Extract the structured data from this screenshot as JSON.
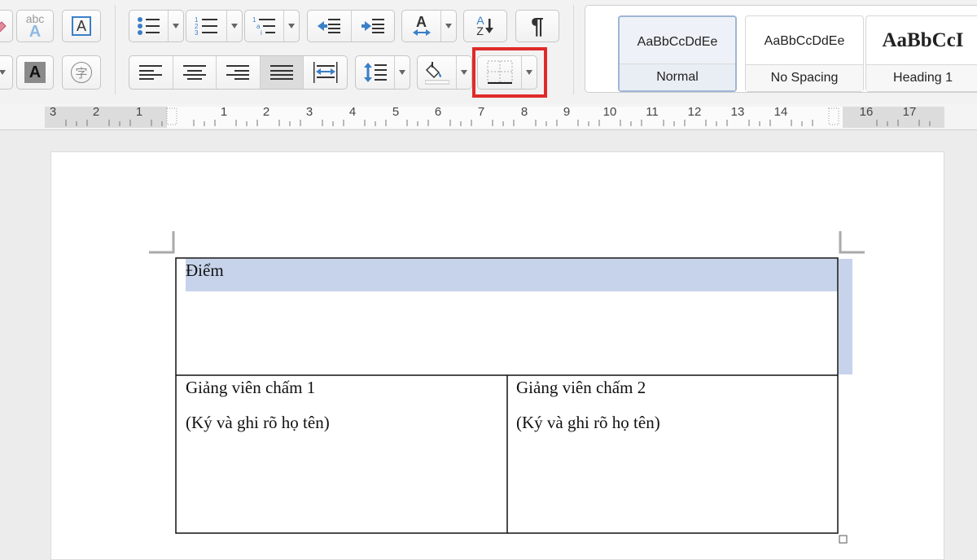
{
  "toolbar": {
    "row1": {
      "clear_format_label": "abc",
      "text_box_label": "A",
      "font_color_label": "A",
      "sort_label_a": "A",
      "sort_label_z": "Z",
      "show_marks_label": "¶"
    },
    "row2": {
      "highlight_label": "A",
      "phonetic_label": "字"
    }
  },
  "styles": [
    {
      "preview": "AaBbCcDdEe",
      "name": "Normal",
      "selected": true
    },
    {
      "preview": "AaBbCcDdEe",
      "name": "No Spacing",
      "selected": false
    },
    {
      "preview": "AaBbCcI",
      "name": "Heading 1",
      "selected": false
    }
  ],
  "ruler": {
    "left_numbers": [
      "3",
      "2",
      "1"
    ],
    "right_numbers": [
      "1",
      "2",
      "3",
      "4",
      "5",
      "6",
      "7",
      "8",
      "9",
      "10",
      "11",
      "12",
      "13",
      "14",
      "16",
      "17"
    ]
  },
  "document": {
    "table": {
      "row1": {
        "text": "Điểm"
      },
      "row2": [
        {
          "line1": "Giảng viên chấm 1",
          "line2": "(Ký và ghi rõ họ tên)"
        },
        {
          "line1": "Giảng viên chấm 2",
          "line2": "(Ký và ghi rõ họ tên)"
        }
      ]
    }
  },
  "colors": {
    "selection": "#c7d3ea",
    "highlight_border": "#e02a2a",
    "icon_blue": "#3a7fc8"
  }
}
